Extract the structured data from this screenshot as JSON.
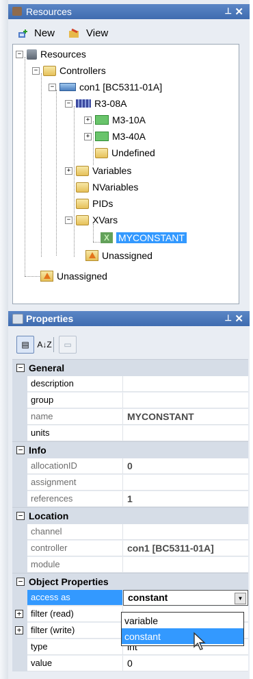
{
  "resources_panel": {
    "title": "Resources",
    "pin": "⊥",
    "close": "✕",
    "toolbar": {
      "new_label": "New",
      "view_label": "View"
    },
    "tree": [
      {
        "label": "Resources",
        "expander": "−"
      },
      {
        "label": "Controllers",
        "expander": "−"
      },
      {
        "label": "con1 [BC5311-01A]",
        "expander": "−"
      },
      {
        "label": "R3-08A",
        "expander": "−"
      },
      {
        "label": "M3-10A",
        "expander": "+"
      },
      {
        "label": "M3-40A",
        "expander": "+"
      },
      {
        "label": "Undefined",
        "expander": ""
      },
      {
        "label": "Variables",
        "expander": "+"
      },
      {
        "label": "NVariables",
        "expander": ""
      },
      {
        "label": "PIDs",
        "expander": ""
      },
      {
        "label": "XVars",
        "expander": "−"
      },
      {
        "label": "MYCONSTANT",
        "expander": "",
        "selected": true
      },
      {
        "label": "Unassigned",
        "expander": ""
      },
      {
        "label": "Unassigned",
        "expander": ""
      }
    ]
  },
  "properties_panel": {
    "title": "Properties",
    "pin": "⊥",
    "close": "✕",
    "toolbar": {
      "categorized_icon": "categorized-icon",
      "sort_icon": "az-sort-icon",
      "sort_label": "A↓Z",
      "pages_icon": "property-pages-icon"
    },
    "categories": [
      {
        "name": "General",
        "rows": [
          {
            "name": "description",
            "value": ""
          },
          {
            "name": "group",
            "value": ""
          },
          {
            "name": "name",
            "value": "MYCONSTANT"
          },
          {
            "name": "units",
            "value": ""
          }
        ]
      },
      {
        "name": "Info",
        "rows": [
          {
            "name": "allocationID",
            "value": "0"
          },
          {
            "name": "assignment",
            "value": ""
          },
          {
            "name": "references",
            "value": "1"
          }
        ]
      },
      {
        "name": "Location",
        "rows": [
          {
            "name": "channel",
            "value": ""
          },
          {
            "name": "controller",
            "value": "con1 [BC5311-01A]"
          },
          {
            "name": "module",
            "value": ""
          }
        ]
      },
      {
        "name": "Object Properties",
        "rows": [
          {
            "name": "access as",
            "value": "constant"
          },
          {
            "name": "filter (read)",
            "value": ""
          },
          {
            "name": "filter (write)",
            "value": ""
          },
          {
            "name": "type",
            "value": "int"
          },
          {
            "name": "value",
            "value": "0"
          }
        ]
      }
    ],
    "dropdown_options": [
      "variable",
      "constant"
    ]
  }
}
